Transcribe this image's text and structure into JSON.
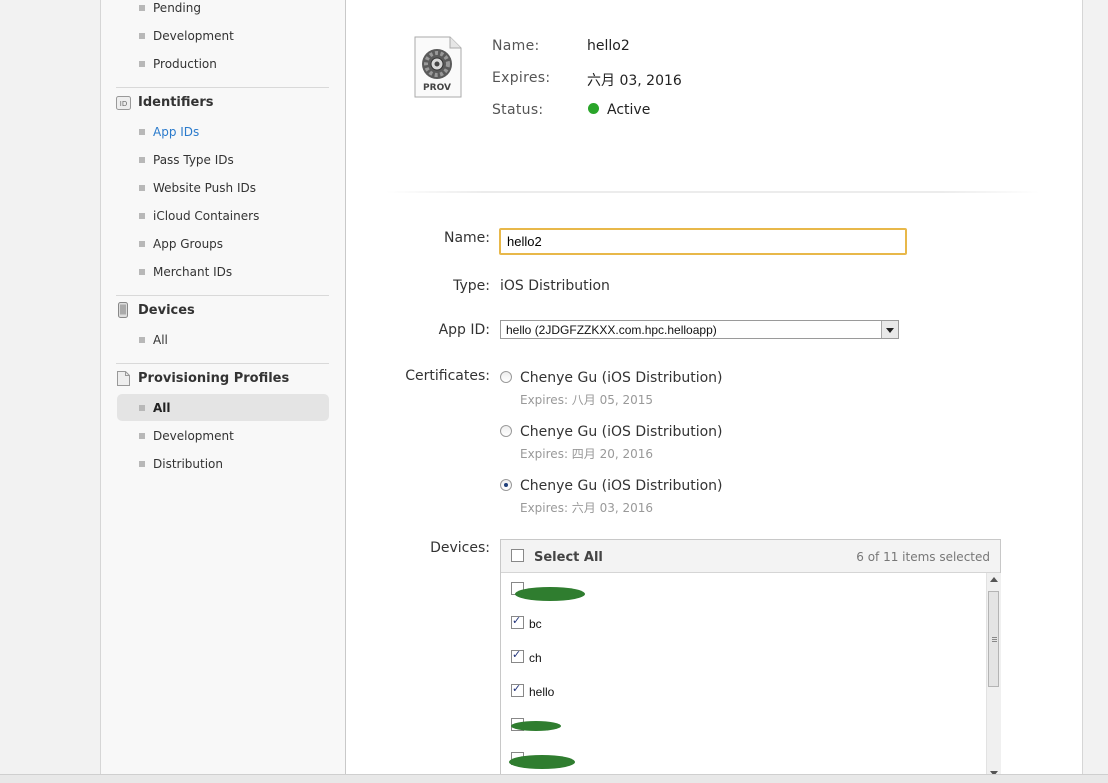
{
  "sidebar": {
    "certificates_items": [
      "Pending",
      "Development",
      "Production"
    ],
    "identifiers_heading": "Identifiers",
    "identifiers_badge": "ID",
    "identifiers_items": [
      "App IDs",
      "Pass Type IDs",
      "Website Push IDs",
      "iCloud Containers",
      "App Groups",
      "Merchant IDs"
    ],
    "devices_heading": "Devices",
    "devices_items": [
      "All"
    ],
    "profiles_heading": "Provisioning Profiles",
    "profiles_items": [
      "All",
      "Development",
      "Distribution"
    ]
  },
  "profile_summary": {
    "icon_label": "PROV",
    "name_label": "Name:",
    "name_value": "hello2",
    "expires_label": "Expires:",
    "expires_value": "六月 03, 2016",
    "status_label": "Status:",
    "status_value": "Active",
    "status_color": "#2aa52a"
  },
  "form": {
    "name_label": "Name:",
    "name_value": "hello2",
    "type_label": "Type:",
    "type_value": "iOS Distribution",
    "appid_label": "App ID:",
    "appid_value": "hello (2JDGFZZKXX.com.hpc.helloapp)",
    "certificates_label": "Certificates:",
    "certificates": [
      {
        "name": "Chenye Gu (iOS Distribution)",
        "expires": "Expires: 八月 05, 2015",
        "selected": false
      },
      {
        "name": "Chenye Gu (iOS Distribution)",
        "expires": "Expires: 四月 20, 2016",
        "selected": false
      },
      {
        "name": "Chenye Gu (iOS Distribution)",
        "expires": "Expires: 六月 03, 2016",
        "selected": true
      }
    ],
    "devices_label": "Devices:",
    "select_all_label": "Select All",
    "selected_count": "6 of 11 items selected",
    "devices": [
      {
        "name": "",
        "checked": false,
        "redacted": true
      },
      {
        "name": "bc",
        "checked": true,
        "redacted": false
      },
      {
        "name": "ch",
        "checked": true,
        "redacted": false
      },
      {
        "name": "hello",
        "checked": true,
        "redacted": false
      },
      {
        "name": "",
        "checked": false,
        "redacted": true
      },
      {
        "name": "",
        "checked": false,
        "redacted": true
      }
    ]
  }
}
